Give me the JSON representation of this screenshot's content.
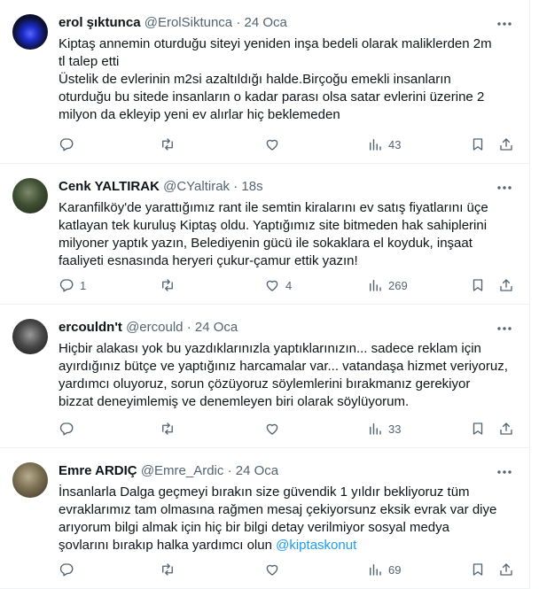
{
  "tweets": [
    {
      "name": "erol şıktunca",
      "handle": "@ErolSiktunca",
      "sep": "·",
      "time": "24 Oca",
      "lines": [
        "Kiptaş annemin oturduğu siteyi yeniden inşa bedeli olarak maliklerden 2m",
        "tl talep etti",
        "Üstelik de evlerinin m2si azaltıldığı halde.Birçoğu emekli insanların",
        "oturduğu bu sitede insanların o kadar parası olsa satar evlerini üzerine 2",
        "milyon da ekleyip yeni ev alırlar hiç beklemeden"
      ],
      "replies": "",
      "retweets": "",
      "likes": "",
      "views": "43"
    },
    {
      "name": "Cenk YALTIRAK",
      "handle": "@CYaltirak",
      "sep": "·",
      "time": "18s",
      "lines": [
        "Karanfilköy'de yarattığımız rant ile semtin kiralarını ev satış fiyatlarını üçe",
        "katlayan tek kuruluş Kiptaş oldu.  Yaptığımız site bitmeden hak sahiplerini",
        "milyoner yaptık yazın, Belediyenin gücü ile sokaklara el koyduk, inşaat",
        "faaliyeti esnasında heryeri çukur-çamur ettik yazın!"
      ],
      "replies": "1",
      "retweets": "",
      "likes": "4",
      "views": "269"
    },
    {
      "name": "ercouldn't",
      "handle": "@ercould",
      "sep": "·",
      "time": "24 Oca",
      "lines": [
        "Hiçbir alakası yok bu yazdıklarınızla yaptıklarınızın... sadece reklam için",
        "ayırdığınız bütçe ve yaptığınız harcamalar var... vatandaşa hizmet veriyoruz,",
        "yardımcı oluyoruz, sorun çözüyoruz söylemlerini bırakmanız gerekiyor",
        "bizzat deneyimlemiş ve denemleyen biri olarak söylüyorum."
      ],
      "replies": "",
      "retweets": "",
      "likes": "",
      "views": "33"
    },
    {
      "name": "Emre ARDIÇ",
      "handle": "@Emre_Ardic",
      "sep": "·",
      "time": "24 Oca",
      "lines": [
        "İnsanlarla Dalga geçmeyi bırakın size güvendik 1 yıldır bekliyoruz tüm",
        "evraklarımız tam olmasına rağmen mesaj çekiyorsunz eksik evrak var diye",
        "arıyorum bilgi almak için hiç bir bilgi detay verilmiyor sosyal medya"
      ],
      "last_line_text": "şovlarını bırakıp halka yardımcı olun ",
      "mention": "@kiptaskonut",
      "replies": "",
      "retweets": "",
      "likes": "",
      "views": "69"
    }
  ],
  "icons": {
    "more": "more-horizontal-icon",
    "reply": "reply-bubble-icon",
    "retweet": "retweet-icon",
    "like": "heart-icon",
    "views": "bar-chart-icon",
    "bookmark": "bookmark-icon",
    "share": "share-upload-icon"
  },
  "colors": {
    "text": "#0f1419",
    "muted": "#536471",
    "link": "#1d9bf0",
    "divider": "#eff3f4"
  }
}
